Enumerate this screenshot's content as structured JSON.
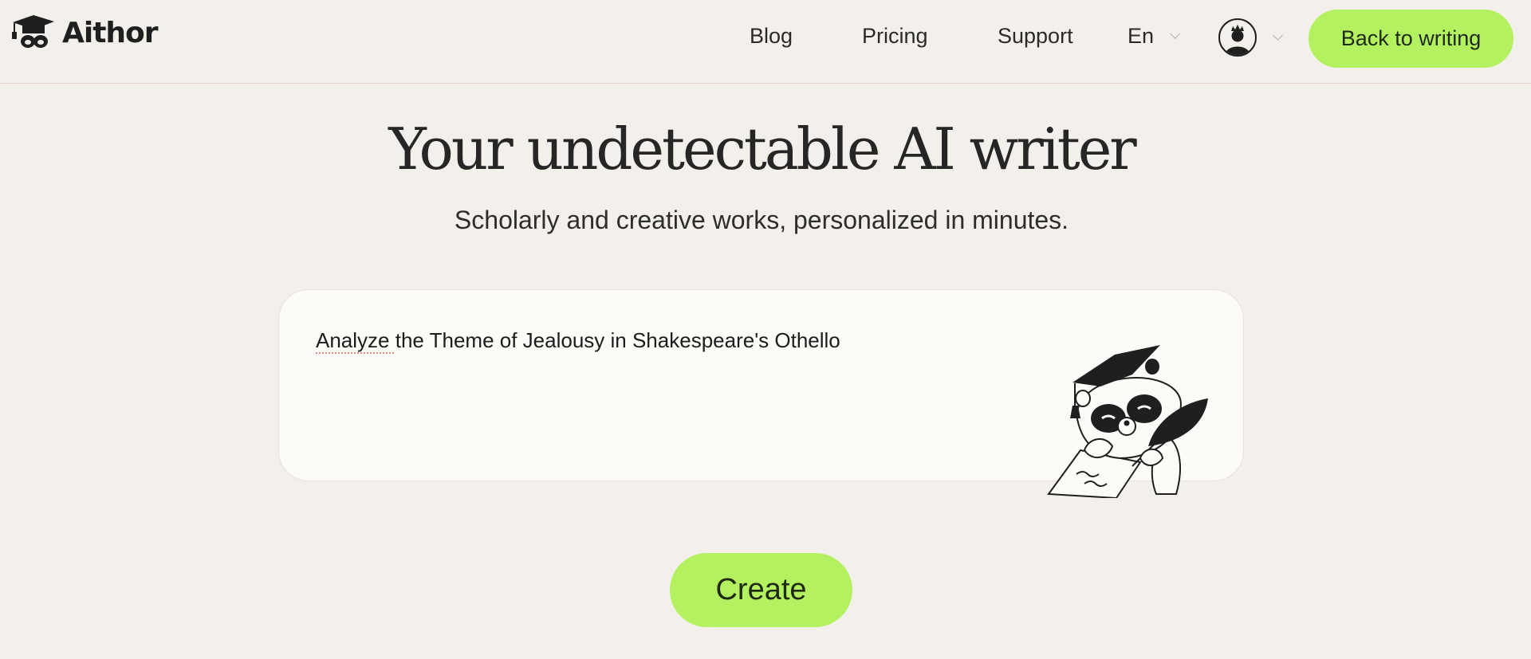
{
  "header": {
    "logo_text": "Aithor",
    "logo_icon": "graduation-cap-mask-icon",
    "nav": [
      {
        "label": "Blog"
      },
      {
        "label": "Pricing"
      },
      {
        "label": "Support"
      }
    ],
    "language": {
      "selected": "En",
      "icon": "chevron-down-icon"
    },
    "avatar": {
      "icon": "user-crown-avatar-icon",
      "menu_icon": "chevron-down-icon"
    },
    "back_button": "Back to writing"
  },
  "hero": {
    "title": "Your undetectable AI writer",
    "subtitle": "Scholarly and creative works, personalized in minutes."
  },
  "prompt": {
    "value": "Analyze the Theme of Jealousy in Shakespeare's Othello",
    "spellcheck_flagged_word": "Analyze",
    "illustration": "raccoon-graduate-writing-illustration"
  },
  "create_button": "Create",
  "colors": {
    "background": "#f3efea",
    "accent": "#b3f160",
    "input_bg": "#fcfbf8",
    "text": "#262626"
  }
}
